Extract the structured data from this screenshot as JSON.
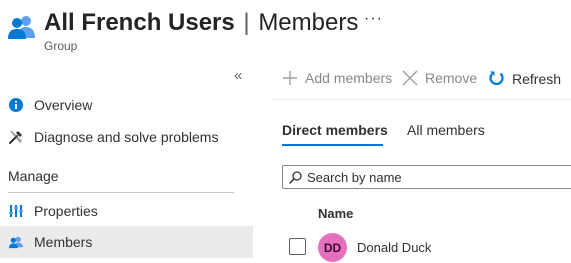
{
  "header": {
    "title_strong": "All French Users",
    "title_separator": "|",
    "title_rest": "Members",
    "subtitle": "Group",
    "more_label": "···"
  },
  "sidebar": {
    "collapse_label": "«",
    "items": [
      {
        "label": "Overview",
        "icon": "info-icon"
      },
      {
        "label": "Diagnose and solve problems",
        "icon": "wrench-icon"
      }
    ],
    "section_label": "Manage",
    "manage_items": [
      {
        "label": "Properties",
        "icon": "properties-icon"
      },
      {
        "label": "Members",
        "icon": "members-icon",
        "selected": true
      }
    ]
  },
  "toolbar": {
    "add_label": "Add members",
    "remove_label": "Remove",
    "refresh_label": "Refresh"
  },
  "tabs": [
    {
      "label": "Direct members",
      "active": true
    },
    {
      "label": "All members",
      "active": false
    }
  ],
  "search": {
    "placeholder": "Search by name"
  },
  "table": {
    "columns": [
      "Name"
    ],
    "rows": [
      {
        "initials": "DD",
        "name": "Donald Duck"
      }
    ]
  },
  "colors": {
    "accent": "#0078d4",
    "avatar": "#e66fbe",
    "selected_nav": "#ebebeb"
  }
}
